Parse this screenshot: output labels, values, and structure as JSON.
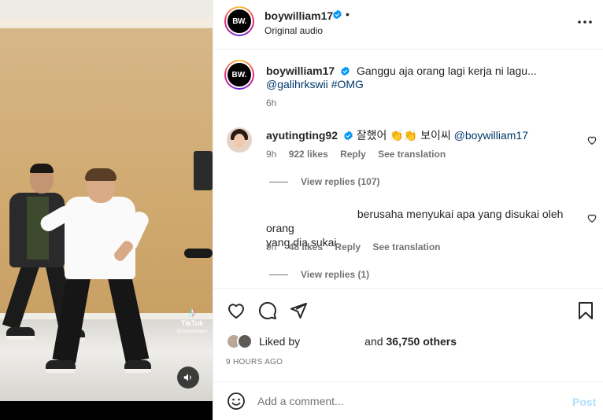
{
  "post": {
    "username": "boywilliam17",
    "avatar_text": "BW.",
    "audio": "Original audio",
    "header_dot": "•",
    "more_icon": "more-horizontal-icon"
  },
  "media": {
    "watermark_brand": "TikTok",
    "watermark_user": "@boywilliam",
    "mute_icon": "speaker-icon"
  },
  "caption": {
    "username": "boywilliam17",
    "text": "Ganggu aja orang lagi kerja ni lagu...",
    "mention": "@galihrkswii",
    "hashtag": "#OMG",
    "time": "6h"
  },
  "comments": [
    {
      "username": "ayutingting92",
      "text_before": "잘했어 👏👏 보이씨",
      "mention": "@boywilliam17",
      "time": "9h",
      "likes": "922 likes",
      "reply": "Reply",
      "translate": "See translation",
      "view_replies": "View replies (107)"
    },
    {
      "text_line1": "berusaha menyukai apa yang disukai oleh orang",
      "text_line2": "yang dia sukai",
      "time": "9h",
      "likes": "48 likes",
      "reply": "Reply",
      "translate": "See translation",
      "view_replies": "View replies (1)"
    }
  ],
  "actions": {
    "like_icon": "heart-icon",
    "comment_icon": "comment-icon",
    "share_icon": "send-icon",
    "save_icon": "bookmark-icon"
  },
  "likes": {
    "prefix": "Liked by",
    "and": "and",
    "others": "36,750 others"
  },
  "timeago": "9 HOURS AGO",
  "add_comment": {
    "placeholder": "Add a comment...",
    "post_label": "Post"
  },
  "colors": {
    "verified": "#0095f6",
    "link": "#00376b",
    "muted": "#737373",
    "post_disabled": "#b2dffc"
  }
}
